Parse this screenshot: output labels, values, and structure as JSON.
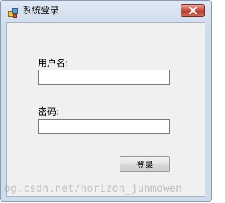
{
  "window": {
    "title": "系统登录"
  },
  "titlebar": {
    "app_icon": "windows-form-icon",
    "close_icon": "close-icon"
  },
  "form": {
    "username_label": "用户名:",
    "username_value": "",
    "password_label": "密码:",
    "password_value": "",
    "login_label": "登录"
  },
  "watermark": {
    "text": "og.csdn.net/horizon_junmowen"
  },
  "colors": {
    "titlebar": "#cfdceb",
    "client_background": "#f0f0f0",
    "close_button": "#c7493b"
  }
}
